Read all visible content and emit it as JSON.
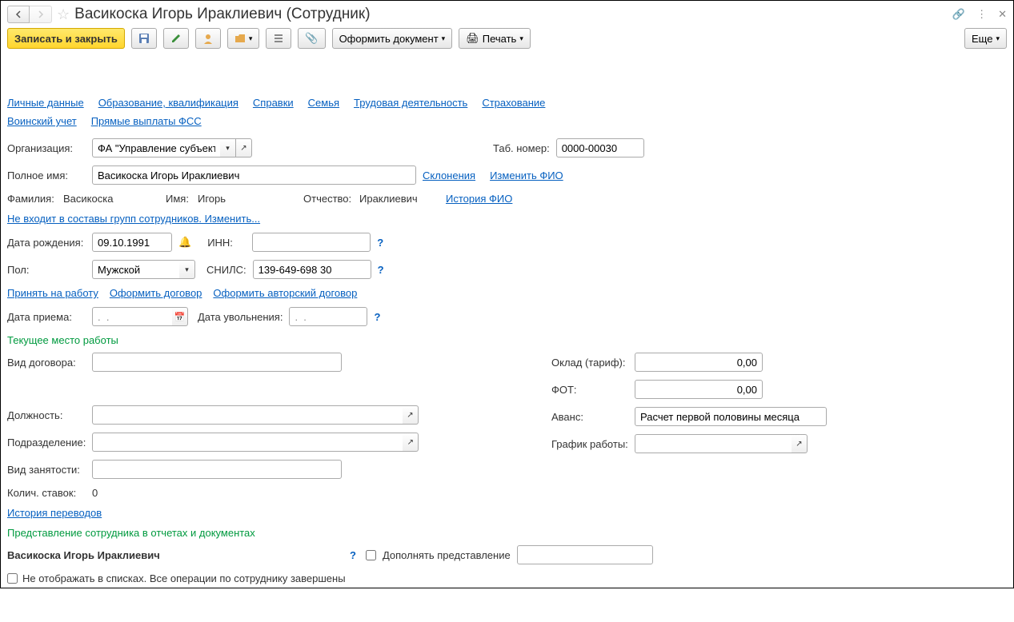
{
  "header": {
    "title": "Васикоска Игорь Ираклиевич (Сотрудник)"
  },
  "toolbar": {
    "save_close": "Записать и закрыть",
    "make_doc": "Оформить документ",
    "print": "Печать",
    "more": "Еще"
  },
  "tabs": {
    "personal": "Личные данные",
    "education": "Образование, квалификация",
    "refs": "Справки",
    "family": "Семья",
    "work": "Трудовая деятельность",
    "insurance": "Страхование",
    "military": "Воинский учет",
    "fss": "Прямые выплаты ФСС"
  },
  "labels": {
    "org": "Организация:",
    "tab_num": "Таб. номер:",
    "full_name": "Полное имя:",
    "declension": "Склонения",
    "change_fio": "Изменить ФИО",
    "surname": "Фамилия:",
    "name": "Имя:",
    "patronymic": "Отчество:",
    "fio_history": "История ФИО",
    "groups_link": "Не входит в составы групп сотрудников. Изменить...",
    "birth": "Дата рождения:",
    "inn": "ИНН:",
    "gender": "Пол:",
    "snils": "СНИЛС:",
    "hire": "Принять на работу",
    "make_contract": "Оформить договор",
    "author_contract": "Оформить авторский договор",
    "hire_date": "Дата приема:",
    "fire_date": "Дата увольнения:",
    "cur_work": "Текущее место работы",
    "contract_type": "Вид договора:",
    "position": "Должность:",
    "department": "Подразделение:",
    "employment": "Вид занятости:",
    "rate_count": "Колич. ставок:",
    "transfer_history": "История переводов",
    "representation_head": "Представление сотрудника в отчетах и документах",
    "supplement": "Дополнять представление",
    "hide_check": "Не отображать в списках. Все операции по сотруднику завершены",
    "salary": "Оклад (тариф):",
    "fot": "ФОТ:",
    "advance": "Аванс:",
    "schedule": "График работы:"
  },
  "values": {
    "org": "ФА \"Управление субъекта",
    "tab_num": "0000-00030",
    "full_name": "Васикоска Игорь Ираклиевич",
    "surname": "Васикоска",
    "name": "Игорь",
    "patronymic": "Ираклиевич",
    "birth": "09.10.1991",
    "gender": "Мужской",
    "snils": "139-649-698 30",
    "hire_date": ".  .",
    "fire_date": ".  .",
    "rate_count": "0",
    "salary": "0,00",
    "fot": "0,00",
    "advance": "Расчет первой половины месяца",
    "representation": "Васикоска Игорь Ираклиевич"
  }
}
